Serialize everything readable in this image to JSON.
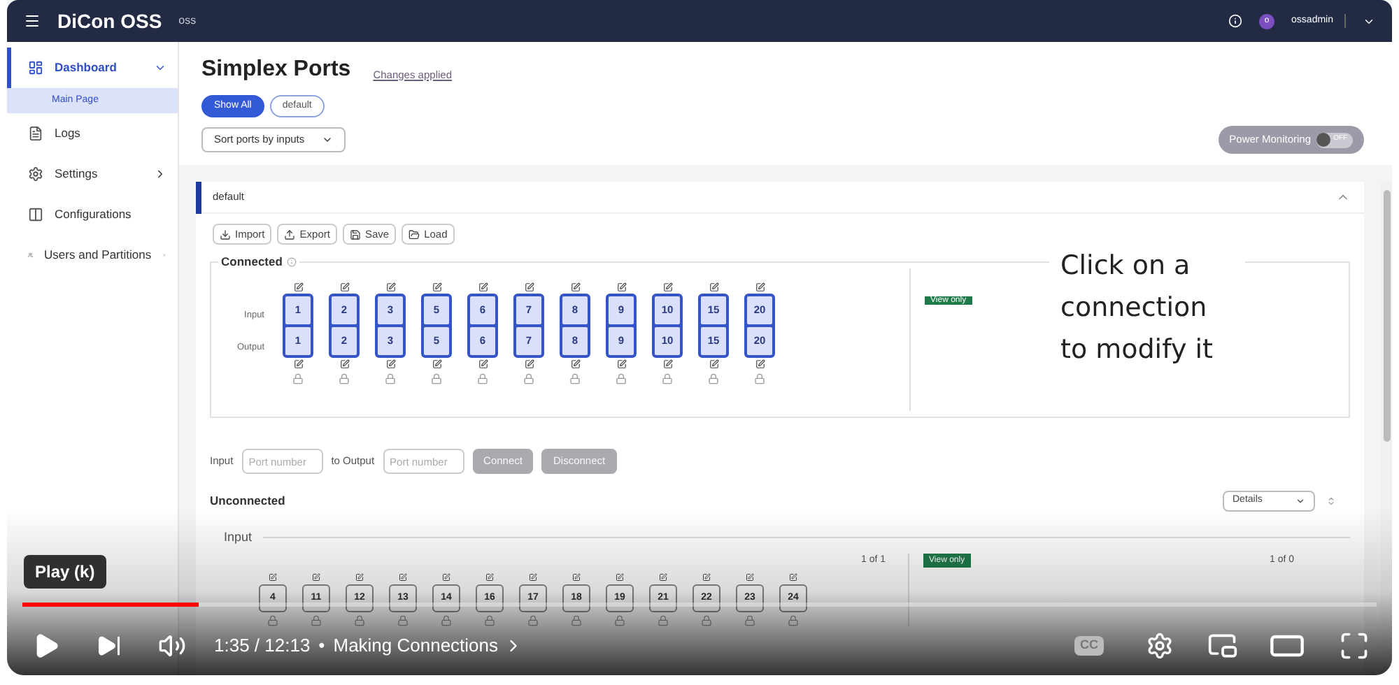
{
  "app": {
    "title": "DiCon OSS",
    "subtitle": "oss",
    "user_initial": "o",
    "user": "ossadmin"
  },
  "sidebar": {
    "items": [
      {
        "label": "Dashboard",
        "selected": true,
        "expanded": true,
        "children": [
          {
            "label": "Main Page",
            "selected": true
          }
        ]
      },
      {
        "label": "Logs",
        "selected": false
      },
      {
        "label": "Settings",
        "selected": false,
        "expanded": false
      },
      {
        "label": "Configurations",
        "selected": false
      },
      {
        "label": "Users and Partitions",
        "selected": false,
        "expanded": false
      }
    ]
  },
  "page": {
    "title": "Simplex Ports",
    "status_link": "Changes applied",
    "filters": [
      {
        "label": "Show All",
        "selected": true
      },
      {
        "label": "default",
        "selected": false
      }
    ],
    "sort_select": "Sort ports by inputs",
    "power_monitoring": {
      "label": "Power Monitoring",
      "on": false,
      "state_text": "OFF"
    }
  },
  "group": {
    "name": "default",
    "expanded": true,
    "actions": [
      "Import",
      "Export",
      "Save",
      "Load"
    ],
    "connected": {
      "title": "Connected",
      "row_labels": [
        "Input",
        "Output"
      ],
      "badge": "View only",
      "connections": [
        {
          "input": "1",
          "output": "1"
        },
        {
          "input": "2",
          "output": "2"
        },
        {
          "input": "3",
          "output": "3"
        },
        {
          "input": "5",
          "output": "5"
        },
        {
          "input": "6",
          "output": "6"
        },
        {
          "input": "7",
          "output": "7"
        },
        {
          "input": "8",
          "output": "8"
        },
        {
          "input": "9",
          "output": "9"
        },
        {
          "input": "10",
          "output": "10"
        },
        {
          "input": "15",
          "output": "15"
        },
        {
          "input": "20",
          "output": "20"
        }
      ]
    },
    "connect_form": {
      "input_label": "Input",
      "input_placeholder": "Port number",
      "output_label": "to Output",
      "output_placeholder": "Port number",
      "buttons": [
        {
          "label": "Connect",
          "disabled": true
        },
        {
          "label": "Disconnect",
          "disabled": true
        }
      ]
    },
    "unconnected": {
      "title": "Unconnected",
      "view_select": "Details",
      "section": "Input",
      "page_left": "1 of 1",
      "badge": "View only",
      "page_right": "1 of 0",
      "inputs": [
        "4",
        "11",
        "12",
        "13",
        "14",
        "16",
        "17",
        "18",
        "19",
        "21",
        "22",
        "23",
        "24"
      ]
    }
  },
  "annotation": "Click on a connection to modify it",
  "player": {
    "tooltip": "Play (k)",
    "level": 0.13,
    "time": "1:35 / 12:13",
    "separator": "•",
    "chapter": "Making Connections",
    "captions_label": "CC"
  }
}
